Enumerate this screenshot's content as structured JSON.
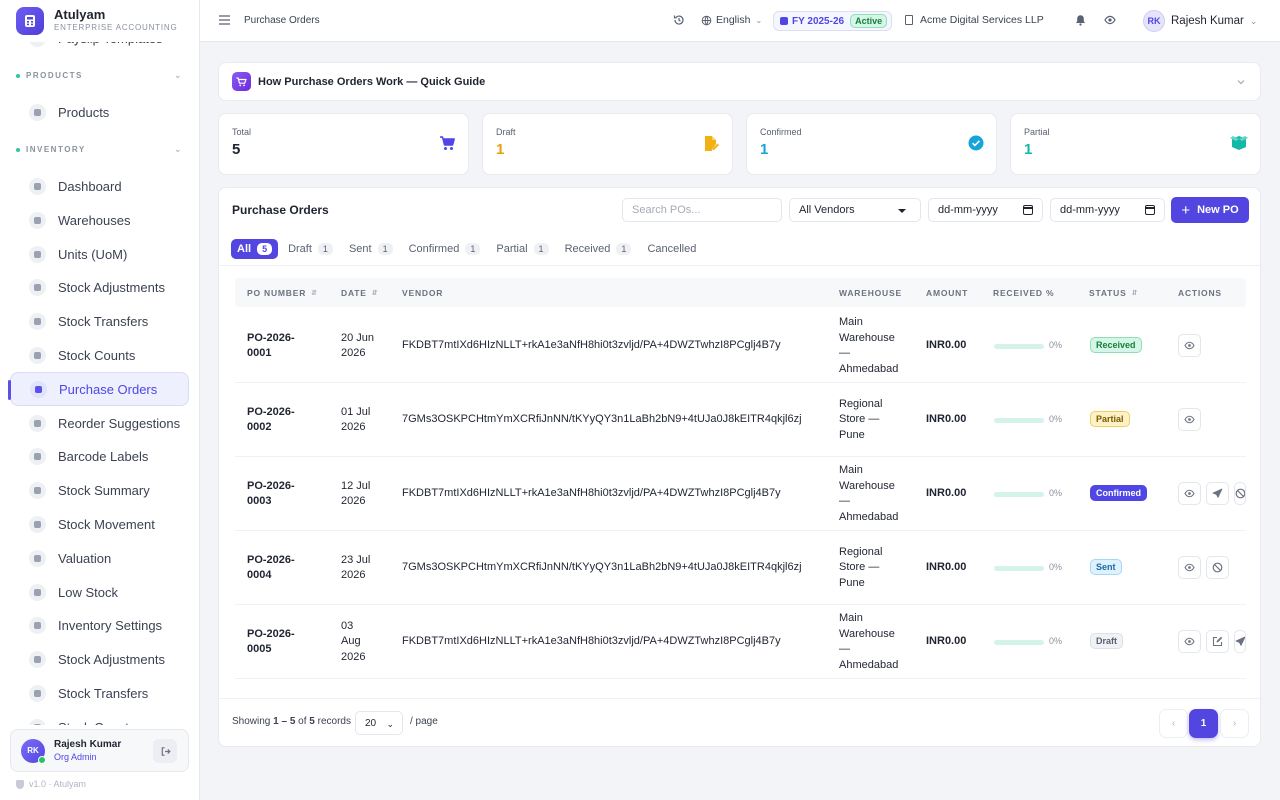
{
  "brand": {
    "name": "Atulyam",
    "subtitle": "ENTERPRISE ACCOUNTING"
  },
  "sidebar": {
    "items": [
      {
        "label": "Payslip Templates",
        "icon": "file-icon"
      },
      {
        "section": "PRODUCTS"
      },
      {
        "label": "Products",
        "icon": "box-icon"
      },
      {
        "section": "INVENTORY"
      },
      {
        "label": "Dashboard",
        "icon": "dashboard-icon"
      },
      {
        "label": "Warehouses",
        "icon": "warehouse-icon"
      },
      {
        "label": "Units (UoM)",
        "icon": "ruler-icon"
      },
      {
        "label": "Stock Adjustments",
        "icon": "sliders-icon"
      },
      {
        "label": "Stock Transfers",
        "icon": "truck-icon"
      },
      {
        "label": "Stock Counts",
        "icon": "clipboard-icon"
      },
      {
        "label": "Purchase Orders",
        "icon": "document-icon",
        "active": true
      },
      {
        "label": "Reorder Suggestions",
        "icon": "bell-icon"
      },
      {
        "label": "Barcode Labels",
        "icon": "barcode-icon"
      },
      {
        "label": "Stock Summary",
        "icon": "chart-icon"
      },
      {
        "label": "Stock Movement",
        "icon": "cycle-icon"
      },
      {
        "label": "Valuation",
        "icon": "coins-icon"
      },
      {
        "label": "Low Stock",
        "icon": "warning-icon"
      },
      {
        "label": "Inventory Settings",
        "icon": "gears-icon"
      },
      {
        "label": "Stock Adjustments",
        "icon": "sliders-icon"
      },
      {
        "label": "Stock Transfers",
        "icon": "arrows-icon"
      },
      {
        "label": "Stock Counts",
        "icon": "clipboard-icon"
      }
    ]
  },
  "user": {
    "initials": "RK",
    "name": "Rajesh Kumar",
    "role": "Org Admin"
  },
  "version": "v1.0 · Atulyam",
  "topbar": {
    "breadcrumb": "Purchase Orders",
    "language": "English",
    "fiscal_year": "FY 2025-26",
    "fy_status": "Active",
    "company": "Acme Digital Services LLP",
    "user_initials": "RK",
    "user_name": "Rajesh Kumar"
  },
  "guide": {
    "title": "How Purchase Orders Work — Quick Guide"
  },
  "stats": [
    {
      "label": "Total",
      "value": "5",
      "color": "#1f2430",
      "icon": "cart-icon"
    },
    {
      "label": "Draft",
      "value": "1",
      "color": "#e5a00d",
      "icon": "edit-file-icon"
    },
    {
      "label": "Confirmed",
      "value": "1",
      "color": "#1aa3d9",
      "icon": "check-circle-icon"
    },
    {
      "label": "Partial",
      "value": "1",
      "color": "#14b8a6",
      "icon": "package-open-icon"
    }
  ],
  "list": {
    "title": "Purchase Orders",
    "search_placeholder": "Search POs...",
    "vendor_filter": "All Vendors",
    "date_from": "dd-mm-yyyy",
    "date_to": "dd-mm-yyyy",
    "new_button": "New PO"
  },
  "tabs": [
    {
      "label": "All",
      "count": "5",
      "active": true
    },
    {
      "label": "Draft",
      "count": "1"
    },
    {
      "label": "Sent",
      "count": "1"
    },
    {
      "label": "Confirmed",
      "count": "1"
    },
    {
      "label": "Partial",
      "count": "1"
    },
    {
      "label": "Received",
      "count": "1"
    },
    {
      "label": "Cancelled",
      "count": ""
    }
  ],
  "columns": [
    "PO NUMBER",
    "DATE",
    "VENDOR",
    "WAREHOUSE",
    "AMOUNT",
    "RECEIVED %",
    "STATUS",
    "ACTIONS"
  ],
  "rows": [
    {
      "po": [
        "PO-2026-",
        "0001"
      ],
      "date": [
        "20 Jun",
        "2026"
      ],
      "vendor": "FKDBT7mtIXd6HIzNLLT+rkA1e3aNfH8hi0t3zvljd/PA+4DWZTwhzI8PCglj4B7y",
      "warehouse": [
        "Main",
        "Warehouse",
        "—",
        "Ahmedabad"
      ],
      "amount": "INR0.00",
      "received": "0%",
      "received_fraction": 0,
      "status": "Received",
      "status_class": "b-received",
      "actions": [
        "eye-icon"
      ]
    },
    {
      "po": [
        "PO-2026-",
        "0002"
      ],
      "date": [
        "01 Jul",
        "2026"
      ],
      "vendor": "7GMs3OSKPCHtmYmXCRfiJnNN/tKYyQY3n1LaBh2bN9+4tUJa0J8kEITR4qkjl6zj",
      "warehouse": [
        "Regional",
        "Store —",
        "Pune"
      ],
      "amount": "INR0.00",
      "received": "0%",
      "received_fraction": 0,
      "status": "Partial",
      "status_class": "b-partial",
      "actions": [
        "eye-icon"
      ]
    },
    {
      "po": [
        "PO-2026-",
        "0003"
      ],
      "date": [
        "12 Jul",
        "2026"
      ],
      "vendor": "FKDBT7mtIXd6HIzNLLT+rkA1e3aNfH8hi0t3zvljd/PA+4DWZTwhzI8PCglj4B7y",
      "warehouse": [
        "Main",
        "Warehouse",
        "—",
        "Ahmedabad"
      ],
      "amount": "INR0.00",
      "received": "0%",
      "received_fraction": 0,
      "status": "Confirmed",
      "status_class": "b-confirmed",
      "actions": [
        "eye-icon",
        "send-icon",
        "cancel-icon"
      ]
    },
    {
      "po": [
        "PO-2026-",
        "0004"
      ],
      "date": [
        "23 Jul",
        "2026"
      ],
      "vendor": "7GMs3OSKPCHtmYmXCRfiJnNN/tKYyQY3n1LaBh2bN9+4tUJa0J8kEITR4qkjl6zj",
      "warehouse": [
        "Regional",
        "Store —",
        "Pune"
      ],
      "amount": "INR0.00",
      "received": "0%",
      "received_fraction": 0,
      "status": "Sent",
      "status_class": "b-sent",
      "actions": [
        "eye-icon",
        "cancel-icon"
      ]
    },
    {
      "po": [
        "PO-2026-",
        "0005"
      ],
      "date": [
        "03",
        "Aug",
        "2026"
      ],
      "vendor": "FKDBT7mtIXd6HIzNLLT+rkA1e3aNfH8hi0t3zvljd/PA+4DWZTwhzI8PCglj4B7y",
      "warehouse": [
        "Main",
        "Warehouse",
        "—",
        "Ahmedabad"
      ],
      "amount": "INR0.00",
      "received": "0%",
      "received_fraction": 0,
      "status": "Draft",
      "status_class": "b-draft",
      "actions": [
        "eye-icon",
        "edit-icon",
        "send-icon"
      ]
    }
  ],
  "footer": {
    "showing_prefix": "Showing",
    "range": "1 – 5",
    "of": "of",
    "total": "5",
    "records": "records",
    "per_page": "20",
    "per_page_label": "/ page",
    "current_page": "1"
  }
}
